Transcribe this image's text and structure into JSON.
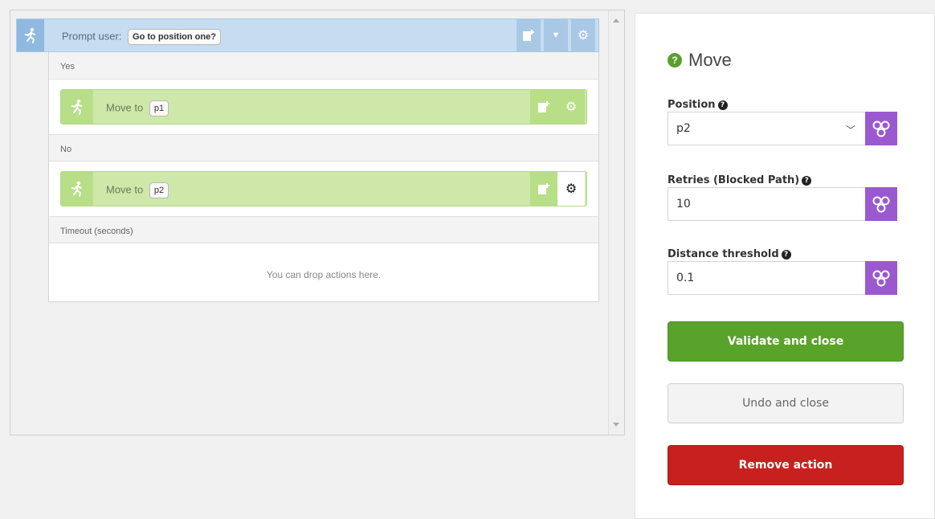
{
  "editor": {
    "prompt": {
      "label": "Prompt user:",
      "question": "Go to position one?"
    },
    "sections": {
      "yes": "Yes",
      "no": "No",
      "timeout": "Timeout (seconds)"
    },
    "move_actions": [
      {
        "label": "Move to",
        "position": "p1"
      },
      {
        "label": "Move to",
        "position": "p2"
      }
    ],
    "drop_hint": "You can drop actions here."
  },
  "panel": {
    "title": "Move",
    "fields": {
      "position": {
        "label": "Position",
        "value": "p2"
      },
      "retries": {
        "label": "Retries (Blocked Path)",
        "value": "10"
      },
      "distance": {
        "label": "Distance threshold",
        "value": "0.1"
      }
    },
    "buttons": {
      "validate": "Validate and close",
      "undo": "Undo and close",
      "remove": "Remove action"
    }
  },
  "colors": {
    "prompt_header": "#c6ddf1",
    "move_block": "#cde8a8",
    "variable_button": "#9b59d0",
    "validate": "#5aa32b",
    "remove": "#c8201e"
  },
  "icons": [
    "runner-icon",
    "paste-icon",
    "chevron-down-icon",
    "gear-icon",
    "question-icon",
    "variable-icon"
  ]
}
